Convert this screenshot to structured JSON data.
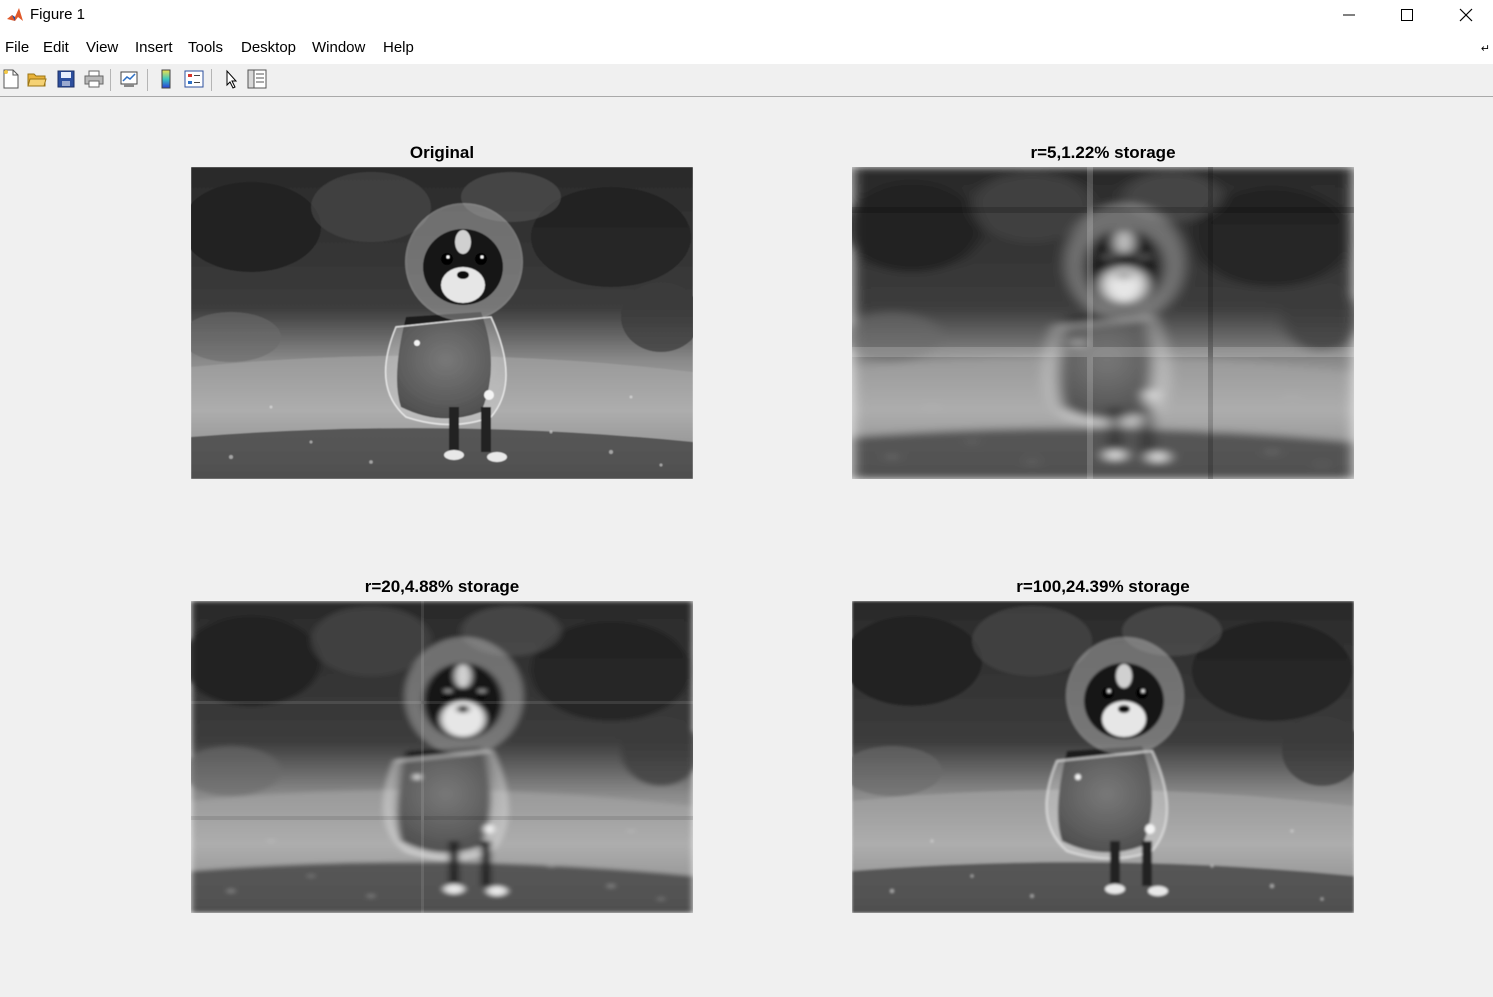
{
  "window": {
    "title": "Figure 1",
    "controls": [
      "minimize-icon",
      "maximize-icon",
      "close-icon"
    ]
  },
  "menu": {
    "items": [
      "File",
      "Edit",
      "View",
      "Insert",
      "Tools",
      "Desktop",
      "Window",
      "Help"
    ],
    "overflow_icon": "dock-arrow-icon"
  },
  "toolbar": {
    "icons": [
      "new-figure-icon",
      "open-file-icon",
      "save-icon",
      "print-icon",
      "link-plot-icon",
      "insert-colorbar-icon",
      "insert-legend-icon",
      "edit-plot-arrow-icon",
      "property-inspector-icon"
    ]
  },
  "subplots": [
    {
      "title": "Original",
      "content": "grayscale photo: chihuahua in clear raincoat"
    },
    {
      "title": "r=5,1.22% storage",
      "content": "rank-5 reconstruction"
    },
    {
      "title": "r=20,4.88% storage",
      "content": "rank-20 reconstruction"
    },
    {
      "title": "r=100,24.39% storage",
      "content": "rank-100 reconstruction"
    }
  ],
  "colors": {
    "figure_bg": "#f0f0f0",
    "titlebar_bg": "#ffffff",
    "matlab_icon": "#e0592a"
  }
}
